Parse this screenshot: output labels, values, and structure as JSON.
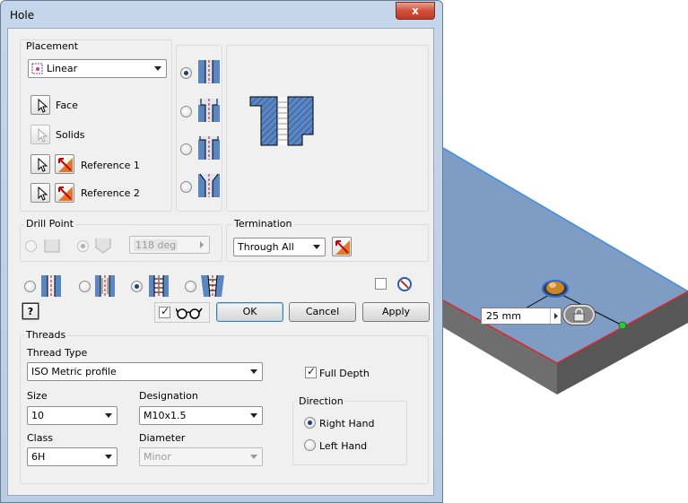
{
  "window": {
    "title": "Hole",
    "close_glyph": "x"
  },
  "placement": {
    "group_label": "Placement",
    "type_value": "Linear",
    "face_label": "Face",
    "solids_label": "Solids",
    "reference1_label": "Reference 1",
    "reference2_label": "Reference 2"
  },
  "hole_types": {
    "selected_index": 0
  },
  "drill_point": {
    "group_label": "Drill Point",
    "angle_value": "118 deg"
  },
  "termination": {
    "group_label": "Termination",
    "value": "Through All"
  },
  "hole_style": {
    "selected_index": 2
  },
  "actions": {
    "ok_label": "OK",
    "cancel_label": "Cancel",
    "apply_label": "Apply",
    "help_glyph": "?"
  },
  "threads": {
    "group_label": "Threads",
    "thread_type_label": "Thread Type",
    "thread_type_value": "ISO Metric profile",
    "full_depth_label": "Full Depth",
    "full_depth_checked": true,
    "size_label": "Size",
    "size_value": "10",
    "designation_label": "Designation",
    "designation_value": "M10x1.5",
    "class_label": "Class",
    "class_value": "6H",
    "diameter_label": "Diameter",
    "diameter_value": "Minor",
    "direction_label": "Direction",
    "right_hand_label": "Right Hand",
    "left_hand_label": "Left Hand",
    "direction_selected": "right"
  },
  "viewport": {
    "dimension_value": "25 mm"
  },
  "colors": {
    "part_top": "#7f9dc4",
    "part_front": "#6c6c6c",
    "part_side": "#555555",
    "edge_blue": "#3b8ee6",
    "edge_red": "#e0242c",
    "hole_gold": "#c8862a"
  }
}
